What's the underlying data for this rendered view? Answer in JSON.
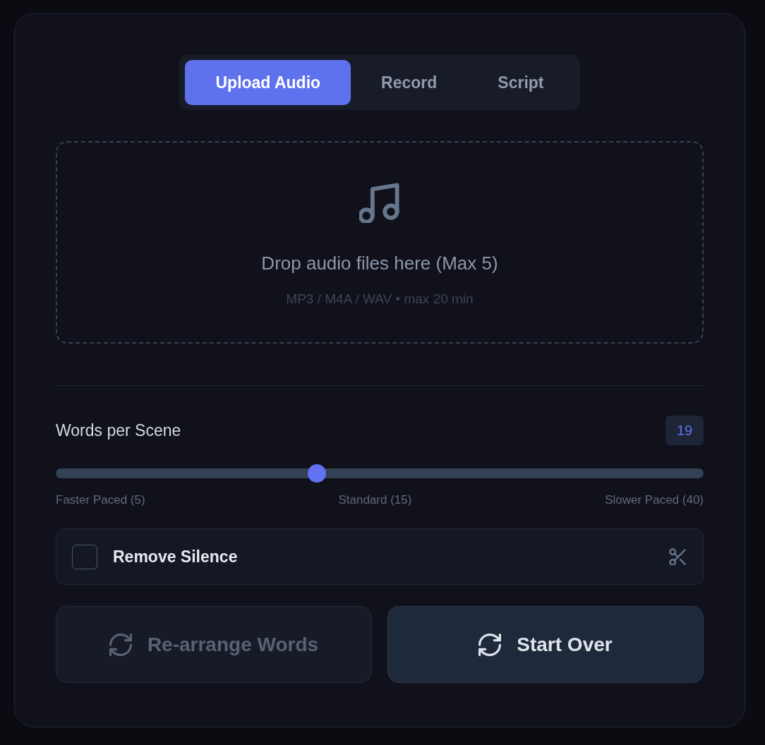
{
  "tabs": [
    {
      "label": "Upload Audio",
      "selected": true
    },
    {
      "label": "Record",
      "selected": false
    },
    {
      "label": "Script",
      "selected": false
    }
  ],
  "dropzone": {
    "title": "Drop audio files here (Max 5)",
    "hint": "MP3 / M4A / WAV • max 20 min"
  },
  "words_per_scene": {
    "label": "Words per Scene",
    "value": "19",
    "level": 0.4,
    "scale_labels": [
      "Faster Paced (5)",
      "Standard (15)",
      "Slower Paced (40)"
    ]
  },
  "remove_silence": {
    "label": "Remove Silence",
    "checked": false
  },
  "buttons": [
    {
      "label": "Re-arrange Words",
      "disabled": true
    },
    {
      "label": "Start Over",
      "disabled": false
    }
  ]
}
